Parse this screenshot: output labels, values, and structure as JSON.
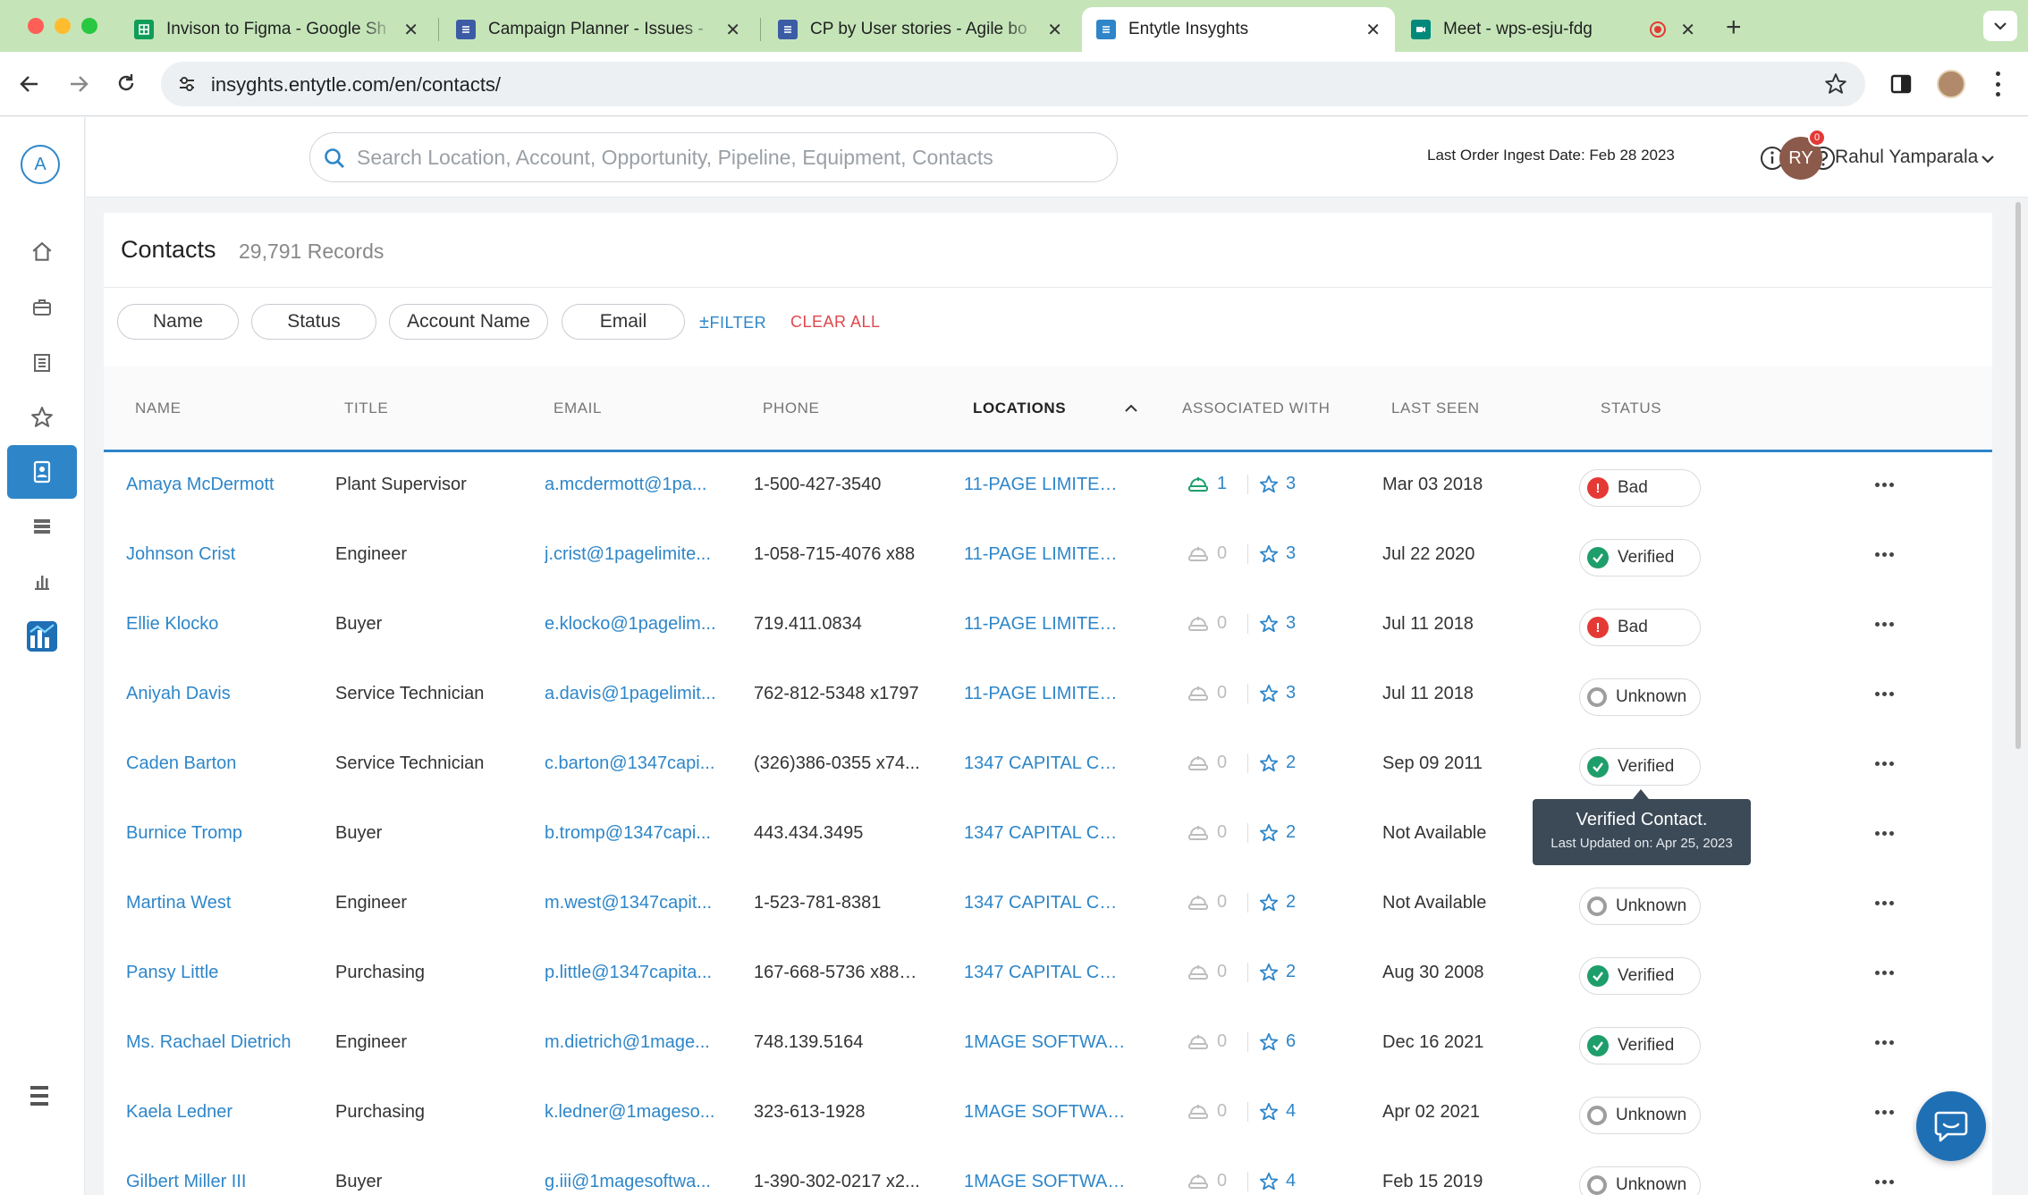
{
  "browser": {
    "tabs": [
      {
        "title": "Invison to Figma - Google Sh",
        "icon": "google-sheets-icon",
        "color": "#0f9d58"
      },
      {
        "title": "Campaign Planner - Issues -",
        "icon": "jira-doc-icon",
        "color": "#3b5ba5"
      },
      {
        "title": "CP by User stories - Agile bo",
        "icon": "jira-doc-icon",
        "color": "#3b5ba5"
      },
      {
        "title": "Entytle Insyghts",
        "icon": "entytle-icon",
        "color": "#2e86c9"
      },
      {
        "title": "Meet - wps-esju-fdg",
        "icon": "google-meet-icon",
        "color": "#00897b"
      }
    ],
    "url": "insyghts.entytle.com/en/contacts/"
  },
  "header": {
    "search_placeholder": "Search Location, Account, Opportunity, Pipeline, Equipment, Contacts",
    "ingest_text": "Last Order Ingest Date: Feb 28 2023",
    "user_initials": "RY",
    "notification_count": "0",
    "user_name": "Rahul Yamparala"
  },
  "sidebar": {
    "logo_letter": "A",
    "items": [
      "home-icon",
      "briefcase-icon",
      "building-icon",
      "star-icon",
      "contacts-icon",
      "list-icon",
      "bar-chart-icon",
      "analytics-icon"
    ]
  },
  "page": {
    "title": "Contacts",
    "record_count": "29,791 Records"
  },
  "filters": {
    "chips": [
      "Name",
      "Status",
      "Account Name",
      "Email"
    ],
    "add_filter": "FILTER",
    "clear_all": "CLEAR ALL"
  },
  "table": {
    "columns": [
      "NAME",
      "TITLE",
      "EMAIL",
      "PHONE",
      "LOCATIONS",
      "ASSOCIATED WITH",
      "LAST SEEN",
      "STATUS"
    ],
    "rows": [
      {
        "name": "Amaya McDermott",
        "title": "Plant Supervisor",
        "email": "a.mcdermott@1pa...",
        "phone": "1-500-427-3540",
        "location": "11-PAGE LIMITED, ...",
        "opps": "1",
        "favs": "3",
        "last_seen": "Mar 03 2018",
        "status": "Bad"
      },
      {
        "name": "Johnson Crist",
        "title": "Engineer",
        "email": "j.crist@1pagelimite...",
        "phone": "1-058-715-4076 x88",
        "location": "11-PAGE LIMITED, ...",
        "opps": "0",
        "favs": "3",
        "last_seen": "Jul 22 2020",
        "status": "Verified"
      },
      {
        "name": "Ellie Klocko",
        "title": "Buyer",
        "email": "e.klocko@1pagelim...",
        "phone": "719.411.0834",
        "location": "11-PAGE LIMITED, ...",
        "opps": "0",
        "favs": "3",
        "last_seen": "Jul 11 2018",
        "status": "Bad"
      },
      {
        "name": "Aniyah Davis",
        "title": "Service Technician",
        "email": "a.davis@1pagelimit...",
        "phone": "762-812-5348 x1797",
        "location": "11-PAGE LIMITED, ...",
        "opps": "0",
        "favs": "3",
        "last_seen": "Jul 11 2018",
        "status": "Unknown"
      },
      {
        "name": "Caden Barton",
        "title": "Service Technician",
        "email": "c.barton@1347capi...",
        "phone": "(326)386-0355 x74...",
        "location": "1347 CAPITAL COR...",
        "opps": "0",
        "favs": "2",
        "last_seen": "Sep 09 2011",
        "status": "Verified"
      },
      {
        "name": "Burnice Tromp",
        "title": "Buyer",
        "email": "b.tromp@1347capi...",
        "phone": "443.434.3495",
        "location": "1347 CAPITAL COR...",
        "opps": "0",
        "favs": "2",
        "last_seen": "Not Available",
        "status": ""
      },
      {
        "name": "Martina West",
        "title": "Engineer",
        "email": "m.west@1347capit...",
        "phone": "1-523-781-8381",
        "location": "1347 CAPITAL COR...",
        "opps": "0",
        "favs": "2",
        "last_seen": "Not Available",
        "status": "Unknown"
      },
      {
        "name": "Pansy Little",
        "title": "Purchasing",
        "email": "p.little@1347capita...",
        "phone": "167-668-5736 x881...",
        "location": "1347 CAPITAL COR...",
        "opps": "0",
        "favs": "2",
        "last_seen": "Aug 30 2008",
        "status": "Verified"
      },
      {
        "name": "Ms. Rachael Dietrich",
        "title": "Engineer",
        "email": "m.dietrich@1mage...",
        "phone": "748.139.5164",
        "location": "1MAGE SOFTWARE...",
        "opps": "0",
        "favs": "6",
        "last_seen": "Dec 16 2021",
        "status": "Verified"
      },
      {
        "name": "Kaela Ledner",
        "title": "Purchasing",
        "email": "k.ledner@1mageso...",
        "phone": "323-613-1928",
        "location": "1MAGE SOFTWARE...",
        "opps": "0",
        "favs": "4",
        "last_seen": "Apr 02 2021",
        "status": "Unknown"
      },
      {
        "name": "Gilbert Miller III",
        "title": "Buyer",
        "email": "g.iii@1magesoftwa...",
        "phone": "1-390-302-0217 x2...",
        "location": "1MAGE SOFTWARE...",
        "opps": "0",
        "favs": "4",
        "last_seen": "Feb 15 2019",
        "status": "Unknown"
      }
    ]
  },
  "tooltip": {
    "title": "Verified Contact.",
    "subtitle": "Last Updated on: Apr 25, 2023"
  },
  "colors": {
    "accent": "#2e86c9",
    "bad": "#e53935",
    "verified": "#1e9e6a",
    "unknown": "#9e9e9e"
  }
}
